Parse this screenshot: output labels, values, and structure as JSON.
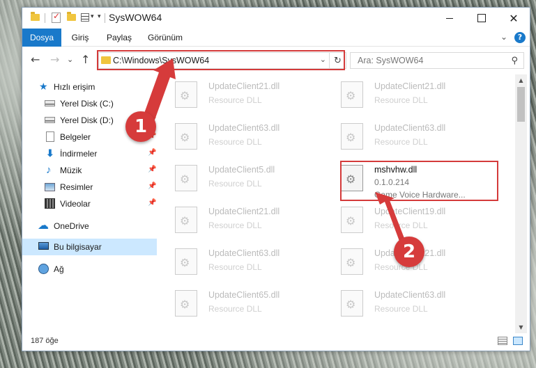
{
  "window": {
    "title": "SysWOW64",
    "controls": {
      "minimize": "",
      "maximize": "",
      "close": "✕"
    }
  },
  "ribbon": {
    "tabs": [
      "Dosya",
      "Giriş",
      "Paylaş",
      "Görünüm"
    ],
    "expand": "⌄",
    "help": "?"
  },
  "nav": {
    "back": "←",
    "forward": "→",
    "recent": "⌄",
    "up": "↑",
    "address": "C:\\Windows\\SysWOW64",
    "refresh": "↻",
    "search_placeholder": "Ara: SysWOW64",
    "search_icon": "⚲"
  },
  "sidebar": {
    "items": [
      {
        "label": "Hızlı erişim",
        "icon": "star-icon",
        "pinned": false
      },
      {
        "label": "Yerel Disk (C:)",
        "icon": "disk-icon",
        "pinned": true
      },
      {
        "label": "Yerel Disk (D:)",
        "icon": "disk-icon",
        "pinned": true
      },
      {
        "label": "Belgeler",
        "icon": "documents-icon",
        "pinned": true
      },
      {
        "label": "İndirmeler",
        "icon": "download-icon",
        "pinned": true
      },
      {
        "label": "Müzik",
        "icon": "music-icon",
        "pinned": true
      },
      {
        "label": "Resimler",
        "icon": "pictures-icon",
        "pinned": true
      },
      {
        "label": "Videolar",
        "icon": "videos-icon",
        "pinned": true
      },
      {
        "label": "OneDrive",
        "icon": "cloud-icon",
        "pinned": false
      },
      {
        "label": "Bu bilgisayar",
        "icon": "computer-icon",
        "pinned": false
      },
      {
        "label": "Ağ",
        "icon": "network-icon",
        "pinned": false
      }
    ],
    "pin_glyph": "📌"
  },
  "files": [
    {
      "name": "UpdateClient21.dll",
      "desc": "Resource DLL"
    },
    {
      "name": "UpdateClient21.dll",
      "desc": "Resource DLL"
    },
    {
      "name": "UpdateClient63.dll",
      "desc": "Resource DLL"
    },
    {
      "name": "UpdateClient63.dll",
      "desc": "Resource DLL"
    },
    {
      "name": "UpdateClient5.dll",
      "desc": "Resource DLL"
    },
    {
      "name": "mshvhw.dll",
      "desc": "0.1.0.214",
      "desc2": "Game Voice Hardware...",
      "focused": true
    },
    {
      "name": "UpdateClient21.dll",
      "desc": "Resource DLL"
    },
    {
      "name": "UpdateClient19.dll",
      "desc": "Resource DLL"
    },
    {
      "name": "UpdateClient63.dll",
      "desc": "Resource DLL"
    },
    {
      "name": "UpdateClient21.dll",
      "desc": "Resource DLL"
    },
    {
      "name": "UpdateClient65.dll",
      "desc": "Resource DLL"
    },
    {
      "name": "UpdateClient63.dll",
      "desc": "Resource DLL"
    }
  ],
  "status": {
    "count": "187 öğe"
  },
  "annotations": {
    "marker1": "1",
    "marker2": "2"
  },
  "colors": {
    "accent": "#1979ca",
    "highlight": "#d43a3a",
    "selected": "#cce8ff"
  }
}
